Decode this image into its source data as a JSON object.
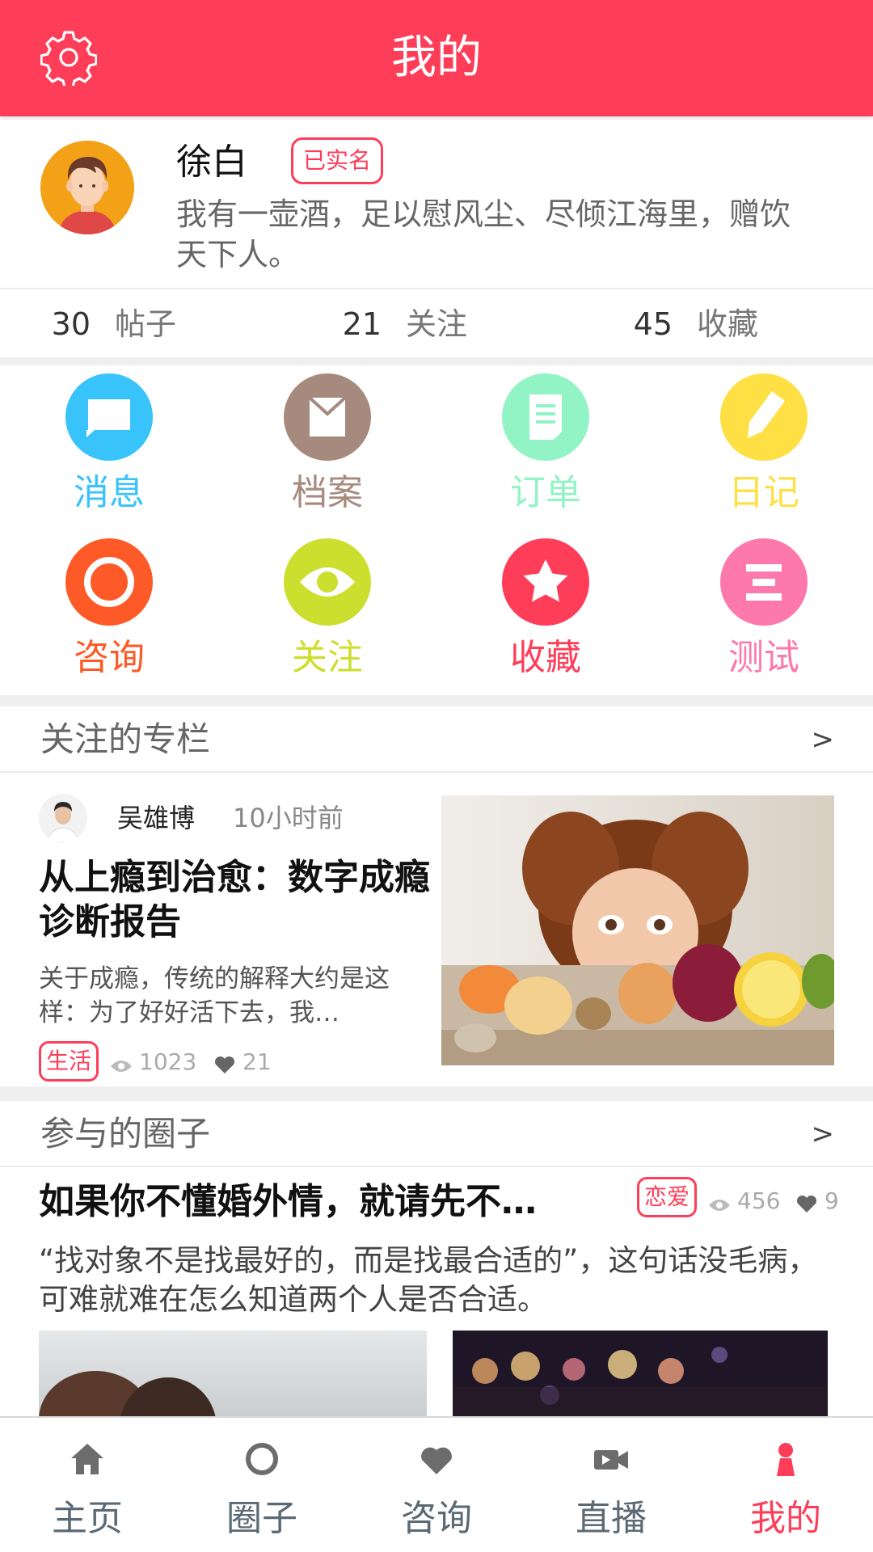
{
  "header": {
    "title": "我的",
    "settings_icon": "gear-icon",
    "bg_color": "#fe3d59"
  },
  "profile": {
    "name": "徐白",
    "badge": "已实名",
    "bio": "我有一壶酒，足以慰风尘、尽倾江海里，赠饮天下人。"
  },
  "stats": [
    {
      "count": "30",
      "label": "帖子"
    },
    {
      "count": "21",
      "label": "关注"
    },
    {
      "count": "45",
      "label": "收藏"
    }
  ],
  "grid": [
    {
      "label": "消息",
      "icon": "message-icon",
      "color": "#38c3fb"
    },
    {
      "label": "档案",
      "icon": "envelope-icon",
      "color": "#a68a7e"
    },
    {
      "label": "订单",
      "icon": "document-icon",
      "color": "#92f3c4"
    },
    {
      "label": "日记",
      "icon": "pencil-icon",
      "color": "#fee045"
    },
    {
      "label": "咨询",
      "icon": "ring-icon",
      "color": "#fd5a27"
    },
    {
      "label": "关注",
      "icon": "eye-icon",
      "color": "#cddf2e"
    },
    {
      "label": "收藏",
      "icon": "star-icon",
      "color": "#fe3d59"
    },
    {
      "label": "测试",
      "icon": "list-icon",
      "color": "#fd78ab"
    }
  ],
  "columns_section": {
    "title": "关注的专栏",
    "arrow": ">",
    "article": {
      "author": "吴雄博",
      "time": "10小时前",
      "title": "从上瘾到治愈：数字成瘾诊断报告",
      "desc": "关于成瘾，传统的解释大约是这样：为了好好活下去，我…",
      "tag": "生活",
      "views": "1023",
      "likes": "21"
    }
  },
  "circles_section": {
    "title": "参与的圈子",
    "arrow": ">",
    "post": {
      "title": "如果你不懂婚外情，就请先不…",
      "tag": "恋爱",
      "views": "456",
      "likes": "9",
      "desc": "“找对象不是找最好的，而是找最合适的”，这句话没毛病，可难就难在怎么知道两个人是否合适。"
    }
  },
  "bottom_nav": [
    {
      "label": "主页",
      "icon": "home-icon",
      "active": false
    },
    {
      "label": "圈子",
      "icon": "circle-icon",
      "active": false
    },
    {
      "label": "咨询",
      "icon": "heart-icon",
      "active": false
    },
    {
      "label": "直播",
      "icon": "video-camera-icon",
      "active": false
    },
    {
      "label": "我的",
      "icon": "person-icon",
      "active": true
    }
  ],
  "colors": {
    "accent": "#fe3d59",
    "nav_inactive": "#5a6a74",
    "nav_icon_inactive": "#6c6c6c"
  }
}
